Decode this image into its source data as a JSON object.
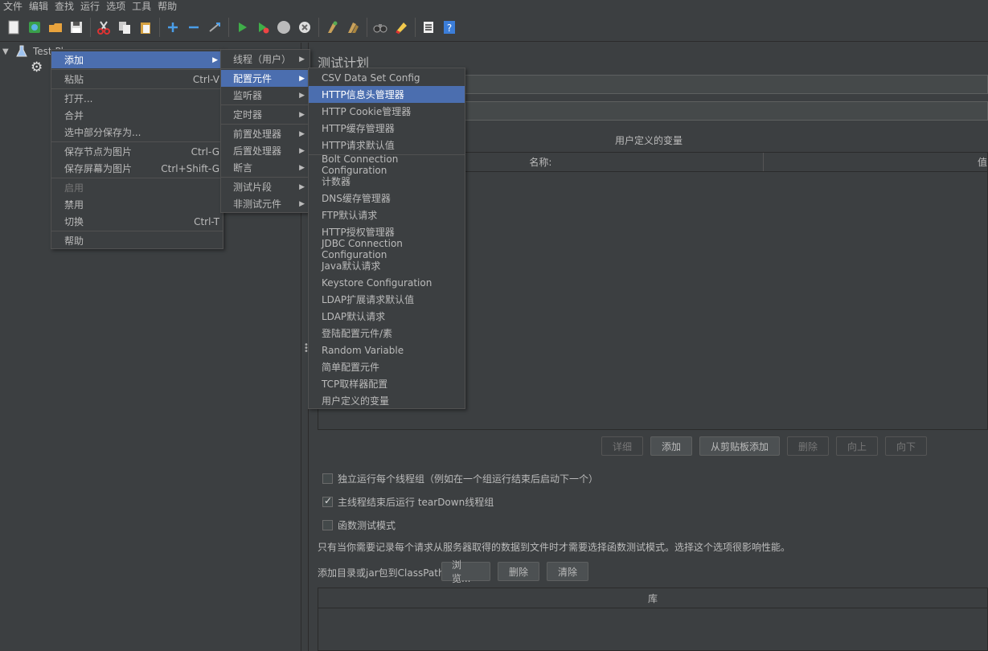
{
  "menubar": [
    "文件",
    "编辑",
    "查找",
    "运行",
    "选项",
    "工具",
    "帮助"
  ],
  "toolbar_icons": [
    "new-icon",
    "templates-icon",
    "open-icon",
    "save-icon",
    "cut-icon",
    "copy-icon",
    "paste-icon",
    "expand-icon",
    "collapse-icon",
    "toggle-icon",
    "start-icon",
    "start-no-pause-icon",
    "stop-icon",
    "shutdown-icon",
    "clear-icon",
    "clear-all-icon",
    "search-icon",
    "reset-search-icon",
    "function-helper-icon",
    "help-icon"
  ],
  "tree": {
    "root": "Test Plan"
  },
  "context_menu": {
    "items": [
      {
        "label": "添加",
        "shortcut": "",
        "submenu": true
      },
      {
        "label": "粘贴",
        "shortcut": "Ctrl-V"
      },
      {
        "label": "打开...",
        "shortcut": ""
      },
      {
        "label": "合并",
        "shortcut": ""
      },
      {
        "label": "选中部分保存为...",
        "shortcut": ""
      },
      {
        "label": "保存节点为图片",
        "shortcut": "Ctrl-G"
      },
      {
        "label": "保存屏幕为图片",
        "shortcut": "Ctrl+Shift-G"
      },
      {
        "label": "启用",
        "shortcut": ""
      },
      {
        "label": "禁用",
        "shortcut": ""
      },
      {
        "label": "切换",
        "shortcut": "Ctrl-T"
      },
      {
        "label": "帮助",
        "shortcut": ""
      }
    ]
  },
  "add_menu": {
    "items": [
      "线程（用户）",
      "配置元件",
      "监听器",
      "定时器",
      "前置处理器",
      "后置处理器",
      "断言",
      "测试片段",
      "非测试元件"
    ]
  },
  "config_menu": {
    "items": [
      "CSV Data Set Config",
      "HTTP信息头管理器",
      "HTTP Cookie管理器",
      "HTTP缓存管理器",
      "HTTP请求默认值",
      "Bolt Connection Configuration",
      "计数器",
      "DNS缓存管理器",
      "FTP默认请求",
      "HTTP授权管理器",
      "JDBC Connection Configuration",
      "Java默认请求",
      "Keystore Configuration",
      "LDAP扩展请求默认值",
      "LDAP默认请求",
      "登陆配置元件/素",
      "Random Variable",
      "简单配置元件",
      "TCP取样器配置",
      "用户定义的变量"
    ]
  },
  "panel": {
    "title": "测试计划",
    "vars_title": "用户定义的变量",
    "col_name": "名称:",
    "col_value": "值",
    "buttons": {
      "detail": "详细",
      "add": "添加",
      "add_clipboard": "从剪贴板添加",
      "delete": "删除",
      "up": "向上",
      "down": "向下"
    },
    "checks": {
      "independent": "独立运行每个线程组（例如在一个组运行结束后启动下一个）",
      "teardown": "主线程结束后运行 tearDown线程组",
      "functional": "函数测试模式"
    },
    "note": "只有当你需要记录每个请求从服务器取得的数据到文件时才需要选择函数测试模式。选择这个选项很影响性能。",
    "classpath_label": "添加目录或jar包到ClassPath",
    "browse": "浏览...",
    "cp_delete": "删除",
    "cp_clear": "清除",
    "lib_header": "库"
  }
}
